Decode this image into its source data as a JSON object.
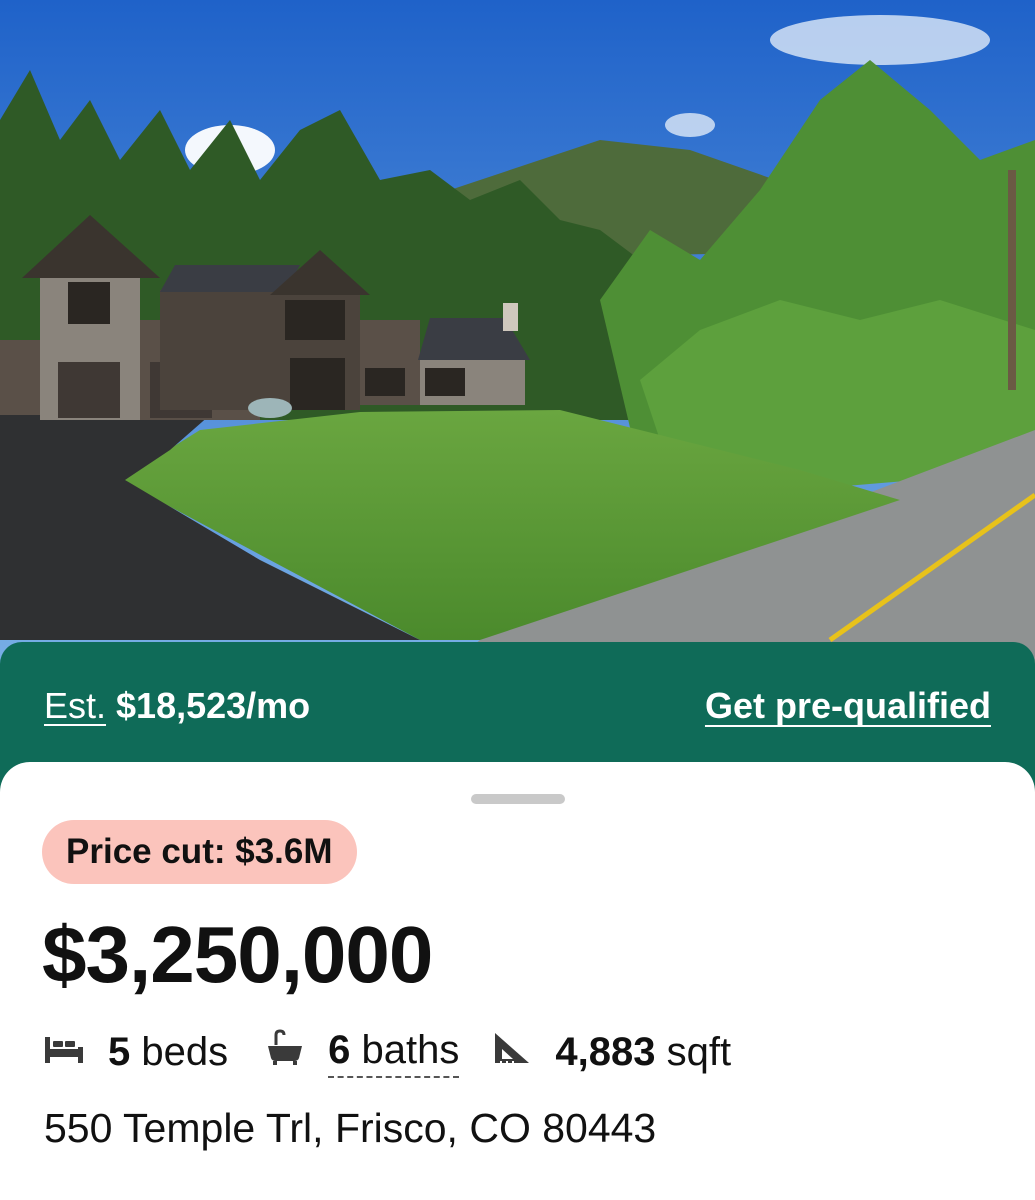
{
  "listing_photo": {
    "description_icon": "house-photo"
  },
  "mortgage": {
    "est_label": "Est.",
    "est_value": "$18,523/mo",
    "cta_label": "Get pre-qualified"
  },
  "listing": {
    "price_cut": "Price cut: $3.6M",
    "price": "$3,250,000",
    "beds_num": "5",
    "beds_label": "beds",
    "baths_num": "6",
    "baths_label": "baths",
    "sqft_num": "4,883",
    "sqft_label": "sqft",
    "address": "550 Temple Trl, Frisco, CO 80443"
  },
  "icons": {
    "beds": "bed-icon",
    "baths": "bathtub-icon",
    "sqft": "ruler-triangle-icon"
  },
  "colors": {
    "accent_green": "#0f6b58",
    "price_cut_bg": "#fbc4bc",
    "text": "#111111"
  }
}
